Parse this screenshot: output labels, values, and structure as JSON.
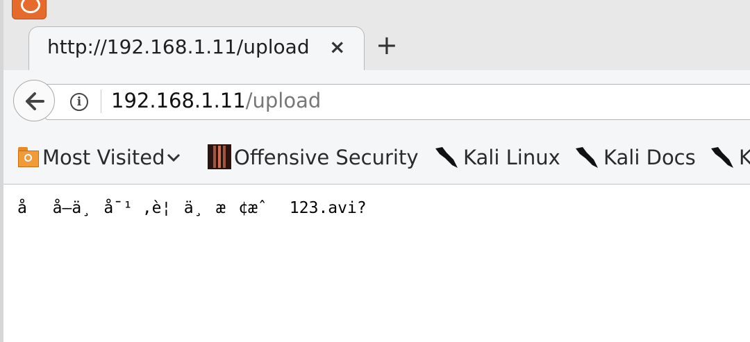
{
  "tab": {
    "title": "http://192.168.1.11/upload",
    "close_glyph": "×",
    "new_tab_glyph": "+"
  },
  "urlbar": {
    "host": "192.168.1.11",
    "path": "/upload"
  },
  "bookmarks": [
    {
      "label": "Most Visited",
      "icon": "folder-icon"
    },
    {
      "label": "Offensive Security",
      "icon": "offsec-icon"
    },
    {
      "label": "Kali Linux",
      "icon": "kali-dragon-icon"
    },
    {
      "label": "Kali Docs",
      "icon": "kali-dragon-icon"
    },
    {
      "label": "K",
      "icon": "kali-dragon-icon"
    }
  ],
  "page": {
    "body_text": "åå–ä¸å¯¹ ,è¦ä¸æ¢æˆ 123.avi?"
  },
  "colors": {
    "accent": "#e66a2c",
    "tabstrip": "#e8e8e8",
    "toolbar": "#f5f6f7"
  }
}
